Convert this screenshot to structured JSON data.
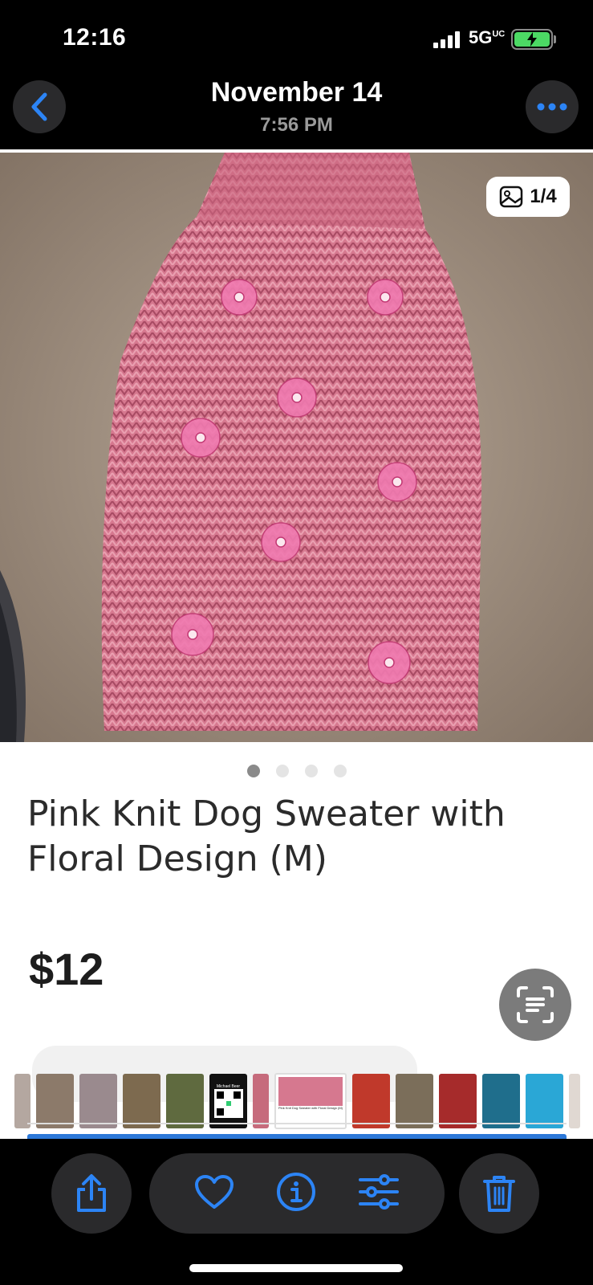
{
  "status_bar": {
    "time": "12:16",
    "network": "5G",
    "network_sup": "UC",
    "battery_charging": true
  },
  "nav": {
    "date": "November 14",
    "time": "7:56 PM",
    "back_icon": "chevron-left-icon",
    "more_icon": "ellipsis-icon"
  },
  "listing": {
    "photo_counter": "1/4",
    "photo_page_dots": 4,
    "photo_page_active": 1,
    "title": "Pink Knit Dog Sweater with Floral Design (M)",
    "price": "$12"
  },
  "thumb_strip": {
    "selected_caption": "Pink Knit Dog Sweater with Floral Design (M)",
    "qr_label": "Michael Beer"
  },
  "toolbar": {
    "share_icon": "share-icon",
    "favorite_icon": "heart-icon",
    "info_icon": "info-icon",
    "adjust_icon": "sliders-icon",
    "delete_icon": "trash-icon"
  },
  "colors": {
    "accent": "#2c84f5",
    "battery": "#4cd964",
    "sweater": "#d9708a"
  }
}
